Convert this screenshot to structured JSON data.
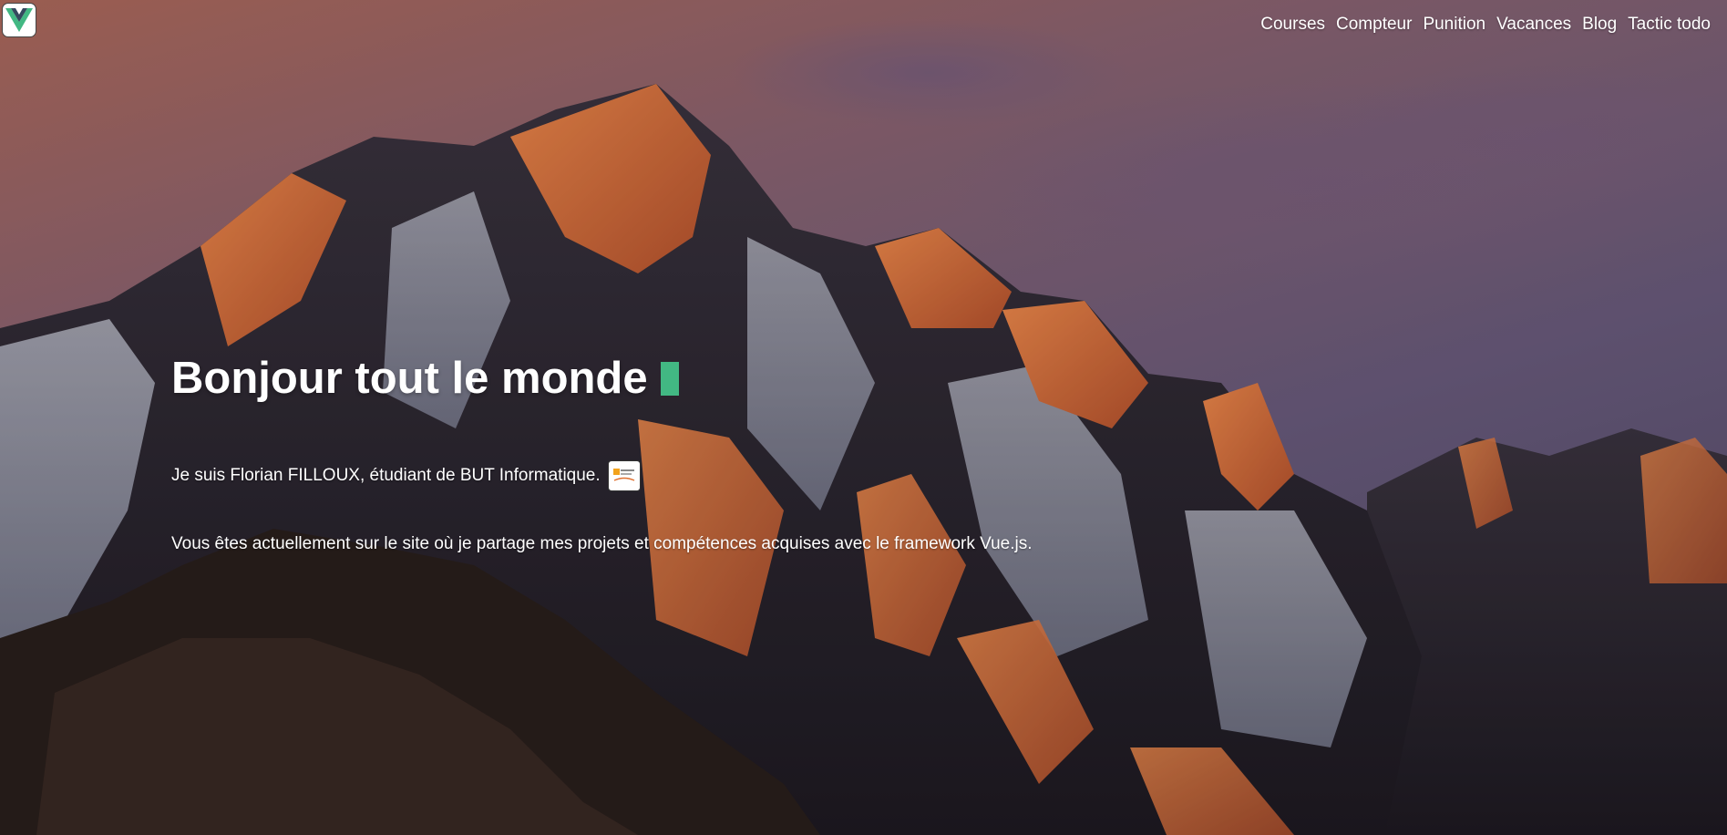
{
  "header": {
    "logo_icon": "vue-logo-icon",
    "nav": [
      {
        "label": "Courses"
      },
      {
        "label": "Compteur"
      },
      {
        "label": "Punition"
      },
      {
        "label": "Vacances"
      },
      {
        "label": "Blog"
      },
      {
        "label": "Tactic todo"
      }
    ]
  },
  "hero": {
    "title": "Bonjour tout le monde",
    "cursor_color": "#42b883",
    "intro": "Je suis Florian FILLOUX, étudiant de BUT Informatique.",
    "badge_icon": "but-informatique-badge-icon",
    "description": "Vous êtes actuellement sur le site où je partage mes projets et compétences acquises avec le framework Vue.js."
  },
  "background": {
    "scene": "mountain-sunset-image",
    "sky_color": "#6e5a7a",
    "glow_color": "#e0763a"
  },
  "colors": {
    "accent": "#42b883",
    "text": "#ffffff"
  }
}
